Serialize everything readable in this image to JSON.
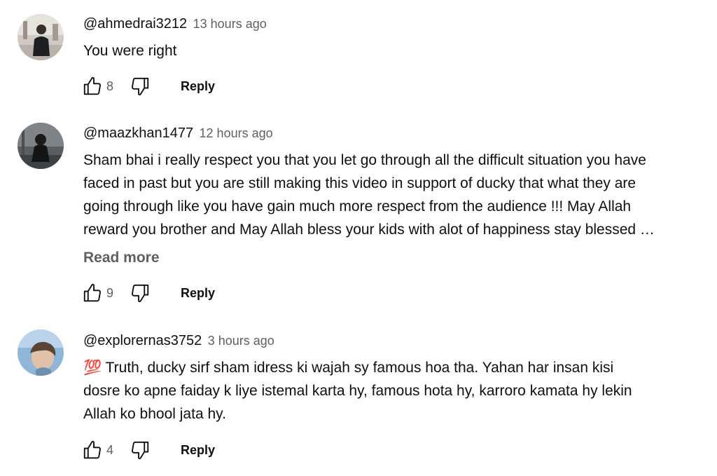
{
  "comments": [
    {
      "author": "@ahmedrai3212",
      "time": "13 hours ago",
      "lines": [
        "You were right"
      ],
      "likes": "8",
      "reply_label": "Reply"
    },
    {
      "author": "@maazkhan1477",
      "time": "12 hours ago",
      "lines": [
        "Sham bhai i really respect you that you let go through all the difficult situation you have",
        "faced in past but you are still making this video in support of ducky that what they are",
        "going through like you have gain much more respect from the audience !!! May Allah",
        "reward you brother and May Allah bless your kids with alot of happiness stay blessed …"
      ],
      "read_more": "Read more",
      "likes": "9",
      "reply_label": "Reply"
    },
    {
      "author": "@explorernas3752",
      "time": "3 hours ago",
      "lines": [
        "💯 Truth, ducky sirf sham idress ki wajah sy famous hoa tha. Yahan har insan kisi",
        "dosre ko apne faiday k liye istemal karta hy, famous hota hy, karroro kamata hy lekin",
        "Allah ko bhool jata hy."
      ],
      "likes": "4",
      "reply_label": "Reply"
    }
  ]
}
